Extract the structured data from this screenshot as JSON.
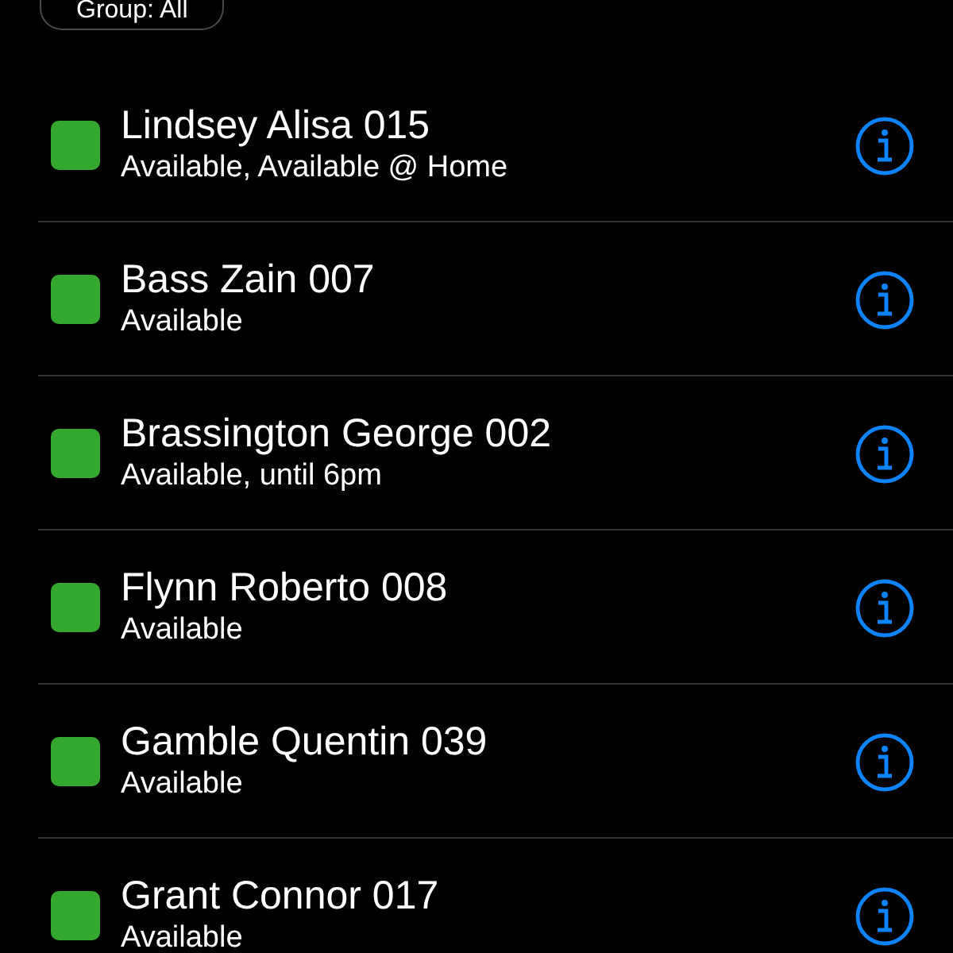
{
  "group_button": {
    "label": "Group: All"
  },
  "contacts": [
    {
      "name": "Lindsey Alisa 015",
      "status": "Available, Available @ Home",
      "color": "#34a82e"
    },
    {
      "name": "Bass Zain 007",
      "status": "Available",
      "color": "#34a82e"
    },
    {
      "name": "Brassington George 002",
      "status": "Available, until 6pm",
      "color": "#34a82e"
    },
    {
      "name": "Flynn Roberto 008",
      "status": "Available",
      "color": "#34a82e"
    },
    {
      "name": "Gamble Quentin 039",
      "status": "Available",
      "color": "#34a82e"
    },
    {
      "name": "Grant Connor 017",
      "status": "Available",
      "color": "#34a82e"
    }
  ]
}
